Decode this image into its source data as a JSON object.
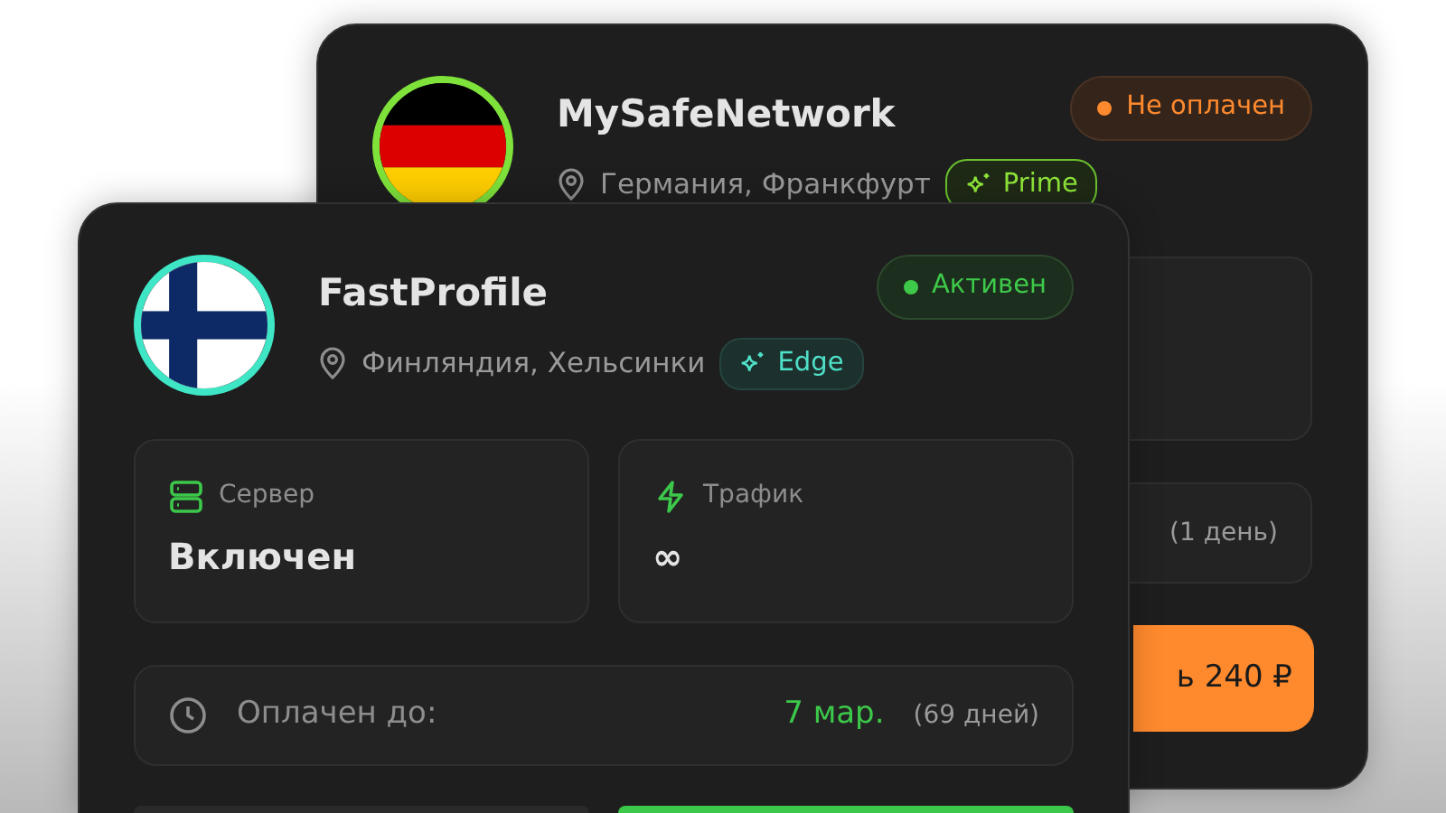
{
  "back_card": {
    "flag": {
      "kind": "germany"
    },
    "title": "MySafeNetwork",
    "status": {
      "label": "Не оплачен",
      "kind": "unpaid"
    },
    "location": "Германия, Франкфурт",
    "tag": {
      "label": "Prime",
      "kind": "prime"
    },
    "payment_note": "(1 день)",
    "pay_button": "ь 240 ₽"
  },
  "front_card": {
    "flag": {
      "kind": "finland"
    },
    "title": "FastProfile",
    "status": {
      "label": "Активен",
      "kind": "active"
    },
    "location": "Финляндия, Хельсинки",
    "tag": {
      "label": "Edge",
      "kind": "edge"
    },
    "stats": [
      {
        "kind": "server",
        "label": "Сервер",
        "value": "Включен"
      },
      {
        "kind": "traffic",
        "label": "Трафик",
        "value": "∞"
      }
    ],
    "paid_until": {
      "label": "Оплачен до:",
      "date": "7 мар.",
      "days": "(69 дней)"
    }
  }
}
